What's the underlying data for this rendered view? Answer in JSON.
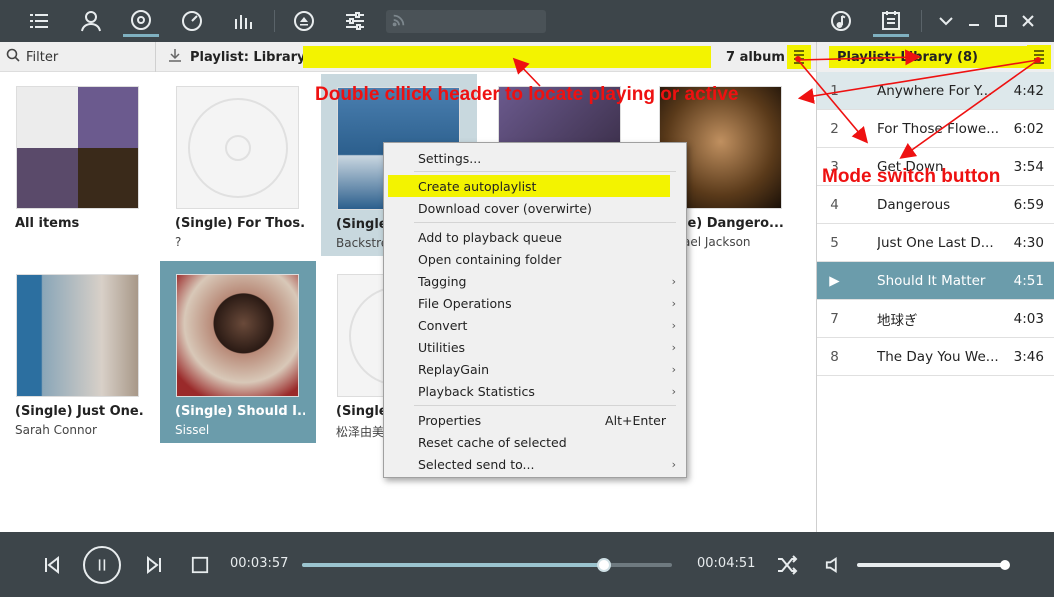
{
  "toolbar": {
    "icons": [
      "menu-icon",
      "user-icon",
      "disc-icon",
      "gauge-icon",
      "equalizer-icon",
      "eject-icon",
      "sliders-icon",
      "rss-icon"
    ],
    "right_icons": [
      "music-note-icon",
      "playlist-icon",
      "chevron-down-icon",
      "minimize-icon",
      "maximize-icon",
      "close-icon"
    ]
  },
  "header": {
    "filter_label": "Filter",
    "playlist_label": "Playlist: Library",
    "album_count": "7 album"
  },
  "albums": [
    {
      "title": "All items",
      "artist": ""
    },
    {
      "title": "(Single) For Thos...",
      "artist": "?"
    },
    {
      "title": "(Single",
      "artist": "Backstre"
    },
    {
      "title": "",
      "artist": ""
    },
    {
      "title": "le) Dangero...",
      "artist": "ael Jackson"
    },
    {
      "title": "(Single) Just One...",
      "artist": "Sarah Connor"
    },
    {
      "title": "(Single) Should I...",
      "artist": "Sissel"
    },
    {
      "title": "(Single",
      "artist": "松泽由美"
    }
  ],
  "context_menu": {
    "items": [
      {
        "label": "Settings...",
        "submenu": false,
        "shortcut": ""
      },
      {
        "label": "Create autoplaylist",
        "submenu": false,
        "shortcut": "",
        "highlight": true
      },
      {
        "label": "Download cover (overwirte)",
        "submenu": false,
        "shortcut": ""
      },
      {
        "label": "Add to playback queue",
        "submenu": false,
        "shortcut": ""
      },
      {
        "label": "Open containing folder",
        "submenu": false,
        "shortcut": ""
      },
      {
        "label": "Tagging",
        "submenu": true,
        "shortcut": ""
      },
      {
        "label": "File Operations",
        "submenu": true,
        "shortcut": ""
      },
      {
        "label": "Convert",
        "submenu": true,
        "shortcut": ""
      },
      {
        "label": "Utilities",
        "submenu": true,
        "shortcut": ""
      },
      {
        "label": "ReplayGain",
        "submenu": true,
        "shortcut": ""
      },
      {
        "label": "Playback Statistics",
        "submenu": true,
        "shortcut": ""
      },
      {
        "label": "Properties",
        "submenu": false,
        "shortcut": "Alt+Enter"
      },
      {
        "label": "Reset cache of selected",
        "submenu": false,
        "shortcut": ""
      },
      {
        "label": "Selected send to...",
        "submenu": true,
        "shortcut": ""
      }
    ],
    "submenu_arrow": "›"
  },
  "right_panel": {
    "title": "Playlist: Library (8)",
    "tracks": [
      {
        "no": "1",
        "title": "Anywhere For Y...",
        "duration": "4:42",
        "state": "current"
      },
      {
        "no": "2",
        "title": "For Those Flowe...",
        "duration": "6:02",
        "state": ""
      },
      {
        "no": "3",
        "title": "Get Down",
        "duration": "3:54",
        "state": ""
      },
      {
        "no": "4",
        "title": "Dangerous",
        "duration": "6:59",
        "state": ""
      },
      {
        "no": "5",
        "title": "Just One Last D...",
        "duration": "4:30",
        "state": ""
      },
      {
        "no": "▶",
        "title": "Should It Matter",
        "duration": "4:51",
        "state": "playing"
      },
      {
        "no": "7",
        "title": "地球ぎ",
        "duration": "4:03",
        "state": ""
      },
      {
        "no": "8",
        "title": "The Day You We...",
        "duration": "3:46",
        "state": ""
      }
    ]
  },
  "annotations": {
    "header_hint": "Double cllick header to locate playing or active",
    "mode_hint": "Mode switch button",
    "color": "#ee1111"
  },
  "player": {
    "elapsed": "00:03:57",
    "total": "00:04:51",
    "progress": 0.815,
    "volume": 1.0
  },
  "colors": {
    "accent": "#6b9cab",
    "highlight": "#f3f300",
    "toolbar_bg": "#3d454a"
  }
}
